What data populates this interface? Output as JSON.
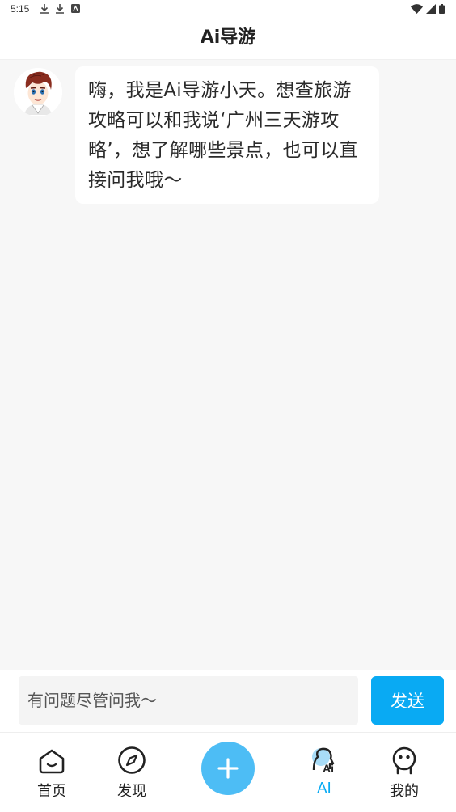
{
  "status_bar": {
    "time": "5:15"
  },
  "header": {
    "title": "Ai导游"
  },
  "chat": {
    "messages": [
      {
        "sender": "bot",
        "text": "嗨，我是Ai导游小天。想查旅游攻略可以和我说‘广州三天游攻略’，想了解哪些景点，也可以直接问我哦～"
      }
    ]
  },
  "input": {
    "placeholder": "有问题尽管问我～",
    "value": "",
    "send_label": "发送"
  },
  "tabs": [
    {
      "label": "首页",
      "icon": "home-icon"
    },
    {
      "label": "发现",
      "icon": "compass-icon"
    },
    {
      "label": "",
      "icon": "plus-icon"
    },
    {
      "label": "AI",
      "icon": "ai-head-icon",
      "active": true
    },
    {
      "label": "我的",
      "icon": "profile-icon"
    }
  ],
  "colors": {
    "accent": "#09aaf3",
    "fab": "#4dbdf5",
    "background": "#f7f7f7"
  }
}
